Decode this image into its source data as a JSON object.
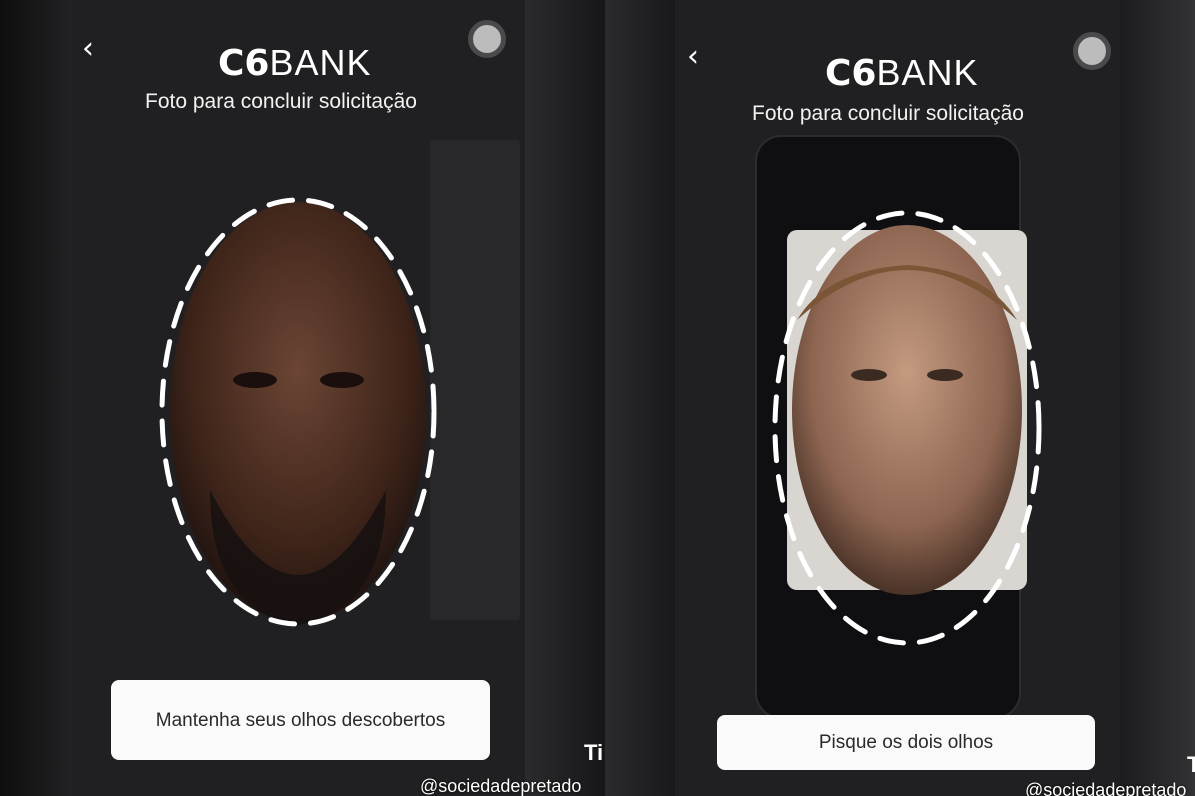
{
  "panels": [
    {
      "brand": {
        "mark": "C6",
        "name": "BANK"
      },
      "subtitle": "Foto para concluir solicitação",
      "instruction": "Mantenha seus olhos descobertos",
      "watermark": "@sociedadepretado",
      "overlay_text": "Ti"
    },
    {
      "brand": {
        "mark": "C6",
        "name": "BANK"
      },
      "subtitle": "Foto para concluir solicitação",
      "instruction": "Pisque os dois olhos",
      "watermark": "@sociedadepretado",
      "overlay_text": "T"
    }
  ],
  "icons": {
    "back": "chevron-left-icon",
    "record": "record-dot-icon"
  },
  "colors": {
    "background": "#201f21",
    "text": "#ffffff",
    "instruction_bg": "#fafafa",
    "face_guide": "#ffffff"
  }
}
